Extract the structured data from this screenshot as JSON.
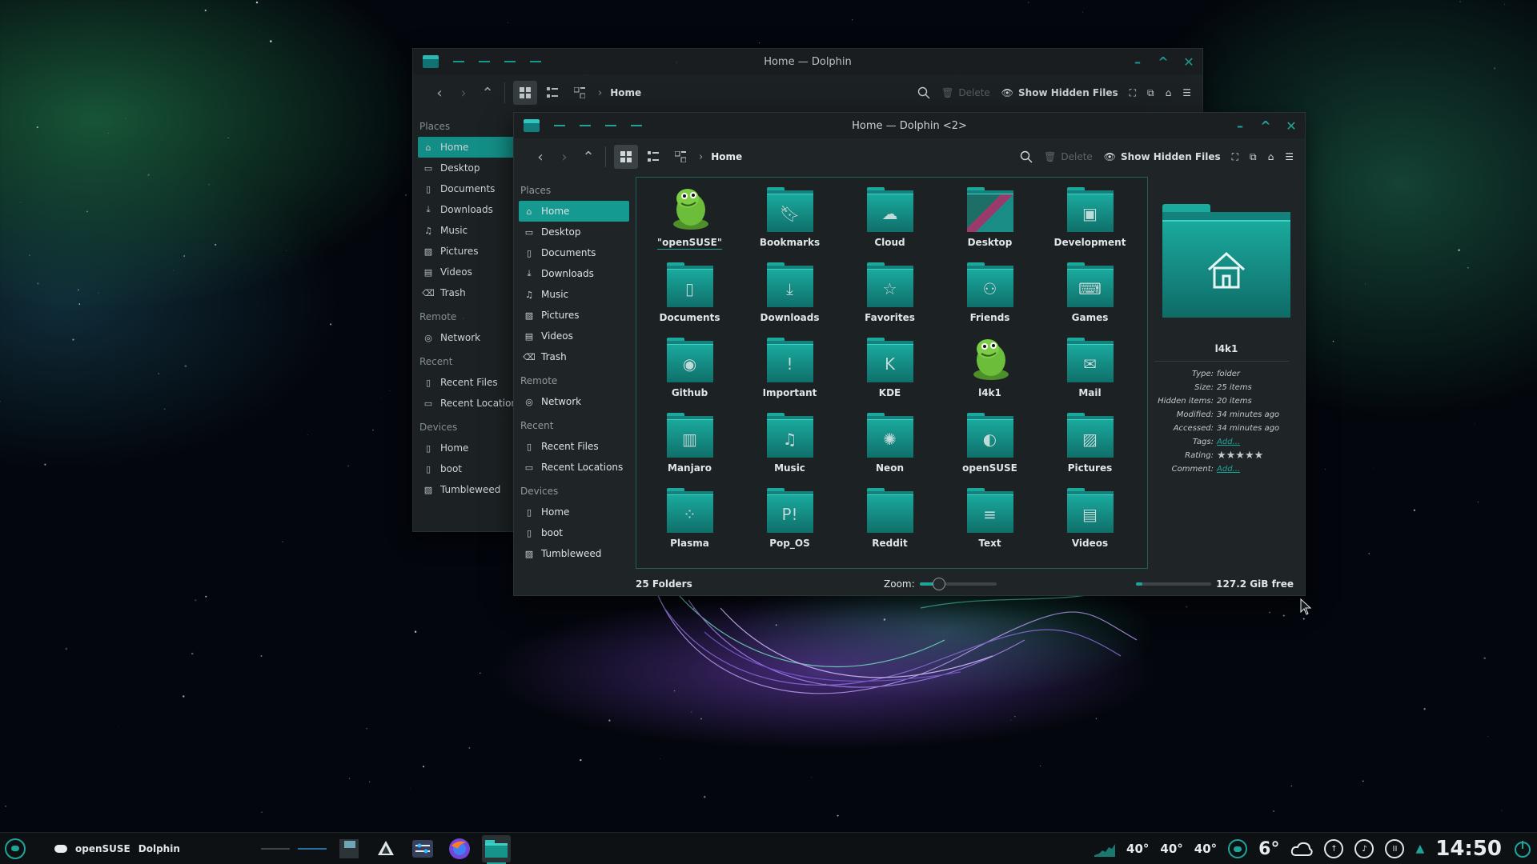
{
  "back_window": {
    "title": "Home — Dolphin",
    "breadcrumb": "Home",
    "toolbar": {
      "delete_label": "Delete",
      "show_hidden_label": "Show Hidden Files"
    },
    "sidebar": {
      "places_heading": "Places",
      "places": [
        "Home",
        "Desktop",
        "Documents",
        "Downloads",
        "Music",
        "Pictures",
        "Videos",
        "Trash"
      ],
      "remote_heading": "Remote",
      "remote": [
        "Network"
      ],
      "recent_heading": "Recent",
      "recent": [
        "Recent Files",
        "Recent Locations"
      ],
      "devices_heading": "Devices",
      "devices": [
        "Home",
        "boot",
        "Tumbleweed"
      ]
    }
  },
  "front_window": {
    "title": "Home — Dolphin <2>",
    "breadcrumb": "Home",
    "toolbar": {
      "delete_label": "Delete",
      "show_hidden_label": "Show Hidden Files"
    },
    "sidebar": {
      "places_heading": "Places",
      "places": [
        "Home",
        "Desktop",
        "Documents",
        "Downloads",
        "Music",
        "Pictures",
        "Videos",
        "Trash"
      ],
      "remote_heading": "Remote",
      "remote": [
        "Network"
      ],
      "recent_heading": "Recent",
      "recent": [
        "Recent Files",
        "Recent Locations"
      ],
      "devices_heading": "Devices",
      "devices": [
        "Home",
        "boot",
        "Tumbleweed"
      ]
    },
    "folders": [
      {
        "label": "\"openSUSE\"",
        "icon": "gecko-image"
      },
      {
        "label": "Bookmarks",
        "icon": "bookmark-icon"
      },
      {
        "label": "Cloud",
        "icon": "cloud-icon"
      },
      {
        "label": "Desktop",
        "icon": "desktop-wallpaper"
      },
      {
        "label": "Development",
        "icon": "window-icon"
      },
      {
        "label": "Documents",
        "icon": "document-icon"
      },
      {
        "label": "Downloads",
        "icon": "download-icon"
      },
      {
        "label": "Favorites",
        "icon": "star-icon"
      },
      {
        "label": "Friends",
        "icon": "people-icon"
      },
      {
        "label": "Games",
        "icon": "gamepad-icon"
      },
      {
        "label": "Github",
        "icon": "github-icon"
      },
      {
        "label": "Important",
        "icon": "exclamation-icon"
      },
      {
        "label": "KDE",
        "icon": "kde-icon"
      },
      {
        "label": "l4k1",
        "icon": "gecko-image"
      },
      {
        "label": "Mail",
        "icon": "mail-icon"
      },
      {
        "label": "Manjaro",
        "icon": "manjaro-icon"
      },
      {
        "label": "Music",
        "icon": "music-note-icon"
      },
      {
        "label": "Neon",
        "icon": "neon-icon"
      },
      {
        "label": "openSUSE",
        "icon": "opensuse-icon"
      },
      {
        "label": "Pictures",
        "icon": "picture-icon"
      },
      {
        "label": "Plasma",
        "icon": "plasma-icon"
      },
      {
        "label": "Pop_OS",
        "icon": "popos-icon"
      },
      {
        "label": "Reddit",
        "icon": "reddit-icon"
      },
      {
        "label": "Text",
        "icon": "text-icon"
      },
      {
        "label": "Videos",
        "icon": "film-icon"
      }
    ],
    "status": {
      "count": "25 Folders",
      "zoom_label": "Zoom:",
      "zoom_level": 0.25,
      "free_space": "127.2 GiB free",
      "used_fraction": 0.08
    },
    "info_panel": {
      "name": "l4k1",
      "rows": [
        {
          "key": "Type:",
          "value": "folder"
        },
        {
          "key": "Size:",
          "value": "25 items"
        },
        {
          "key": "Hidden items:",
          "value": "20 items"
        },
        {
          "key": "Modified:",
          "value": "34 minutes ago"
        },
        {
          "key": "Accessed:",
          "value": "34 minutes ago"
        },
        {
          "key": "Tags:",
          "value": "Add..."
        },
        {
          "key": "Rating:",
          "value": "★★★★★"
        },
        {
          "key": "Comment:",
          "value": "Add..."
        }
      ]
    }
  },
  "taskbar": {
    "distro_label": "openSUSE",
    "app_label": "Dolphin",
    "temps": [
      "40°",
      "40°",
      "40°"
    ],
    "weather": "6°",
    "clock": "14:50"
  },
  "colors": {
    "accent": "#1ea59a",
    "window_bg": "#1f2426",
    "folder": "#1aa99d"
  }
}
